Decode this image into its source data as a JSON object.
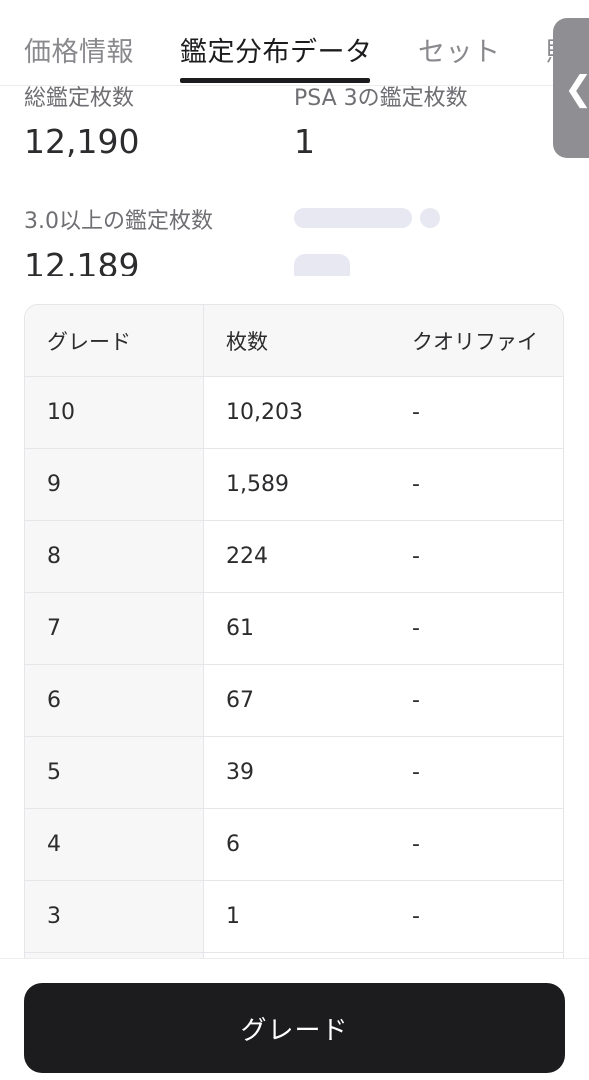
{
  "tabs": [
    {
      "label": "価格情報"
    },
    {
      "label": "鑑定分布データ"
    },
    {
      "label": "セット"
    },
    {
      "label": "販"
    }
  ],
  "side_handle": {
    "icon": "chevron-left-icon",
    "glyph": "❮"
  },
  "stats": {
    "total_label": "総鑑定枚数",
    "total_value": "12,190",
    "psa3_label": "PSA 3の鑑定枚数",
    "psa3_value": "1",
    "above_label": "3.0以上の鑑定枚数",
    "above_value": "12,189"
  },
  "table": {
    "headers": [
      "グレード",
      "枚数",
      "クオリファイ"
    ],
    "rows": [
      {
        "grade": "10",
        "count": "10,203",
        "qualified": "-"
      },
      {
        "grade": "9",
        "count": "1,589",
        "qualified": "-"
      },
      {
        "grade": "8",
        "count": "224",
        "qualified": "-"
      },
      {
        "grade": "7",
        "count": "61",
        "qualified": "-"
      },
      {
        "grade": "6",
        "count": "67",
        "qualified": "-"
      },
      {
        "grade": "5",
        "count": "39",
        "qualified": "-"
      },
      {
        "grade": "4",
        "count": "6",
        "qualified": "-"
      },
      {
        "grade": "3",
        "count": "1",
        "qualified": "-"
      }
    ]
  },
  "bottom": {
    "button_label": "グレード"
  },
  "colors": {
    "accent": "#1c1c1e",
    "skeleton": "#e7e8f1",
    "handle": "#8e8e93"
  }
}
